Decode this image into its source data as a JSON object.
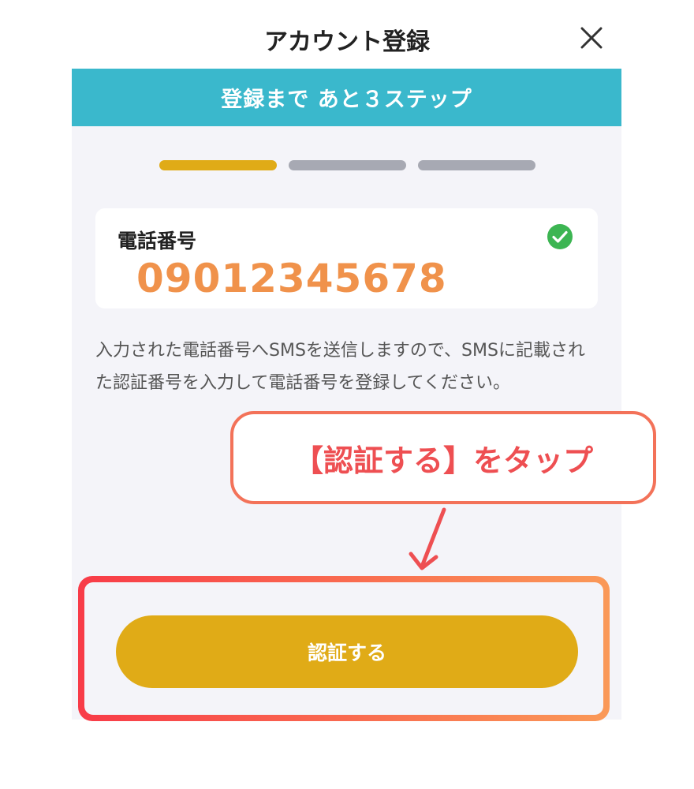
{
  "header": {
    "title": "アカウント登録"
  },
  "banner": {
    "text": "登録まで あと３ステップ"
  },
  "progress": {
    "total_steps": 3,
    "current_step": 1
  },
  "phone": {
    "label": "電話番号",
    "value": "09012345678",
    "verified": true
  },
  "description": "入力された電話番号へSMSを送信しますので、SMSに記載された認証番号を入力して電話番号を登録してください。",
  "annotation": {
    "callout_text": "【認証する】をタップ"
  },
  "actions": {
    "verify_label": "認証する"
  },
  "colors": {
    "banner": "#3ab8cc",
    "progress_active": "#e0ab17",
    "progress_inactive": "#a7a9b3",
    "phone_value": "#f0924b",
    "button": "#e0ab17",
    "check": "#3cb552",
    "annotation": "#ee4f52"
  }
}
